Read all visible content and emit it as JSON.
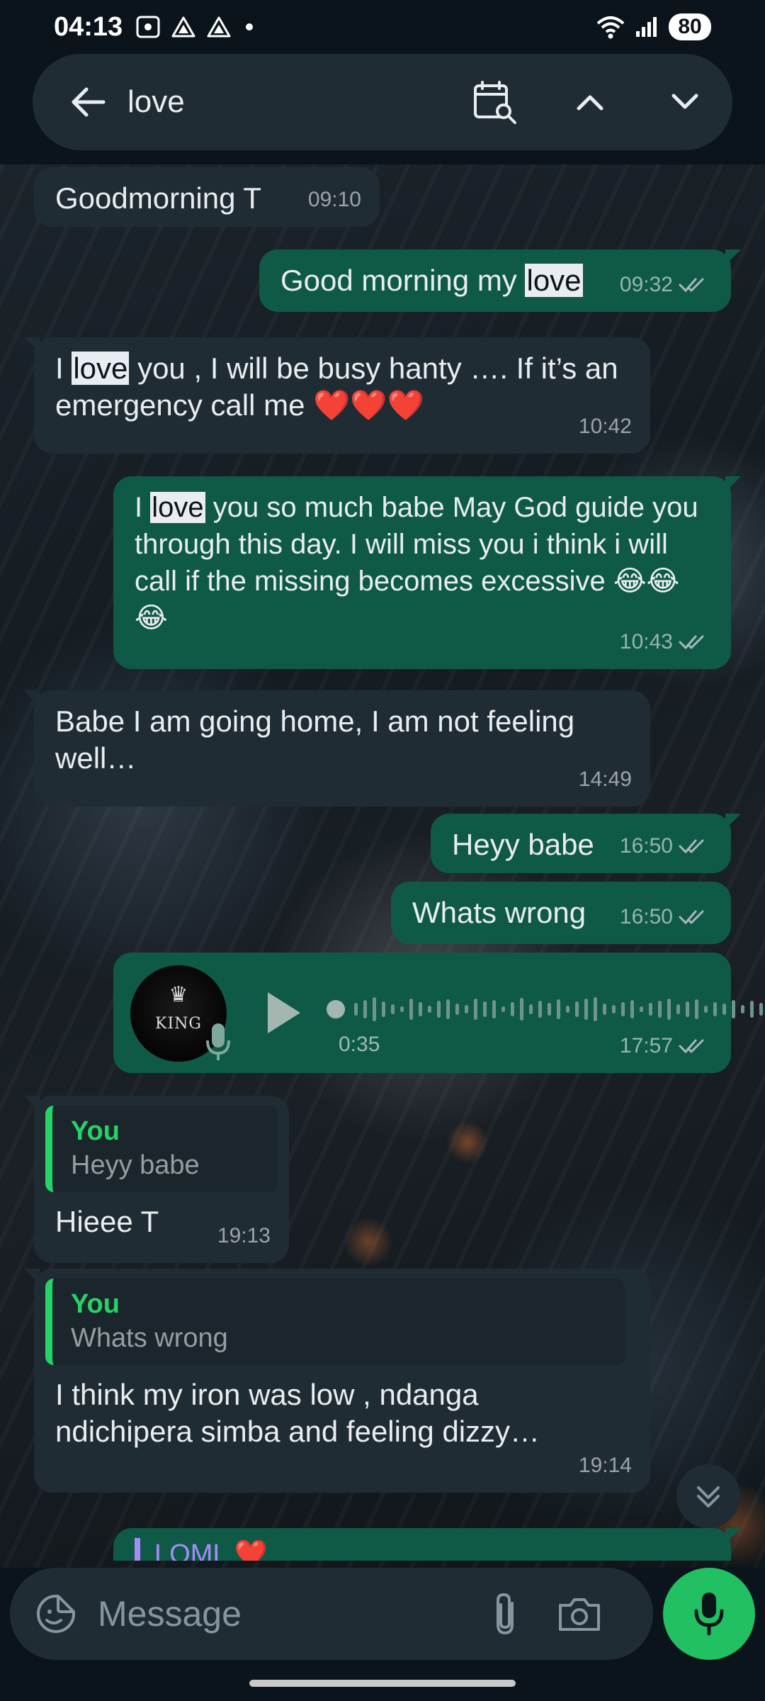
{
  "status_bar": {
    "time": "04:13",
    "battery": "80"
  },
  "search": {
    "query": "love"
  },
  "messages": {
    "m1": {
      "text": "Goodmorning T",
      "time": "09:10"
    },
    "m2": {
      "before": "Good morning my ",
      "highlight": "love",
      "after": "",
      "time": "09:32"
    },
    "m3": {
      "before": "I ",
      "highlight": "love",
      "after": " you , I will be busy hanty …. If it’s an emergency call me ❤️❤️❤️",
      "time": "10:42"
    },
    "m4": {
      "before": "I ",
      "highlight": "love",
      "after": " you so much babe May God guide you through this day. I will miss you i think i will call if the missing becomes excessive 😂😂😂",
      "time": "10:43"
    },
    "m5": {
      "text": "Babe I am going home, I am not feeling well…",
      "time": "14:49"
    },
    "m6": {
      "text": "Heyy babe",
      "time": "16:50"
    },
    "m7": {
      "text": "Whats wrong",
      "time": "16:50"
    },
    "m8": {
      "avatar_text": "KING",
      "duration": "0:35",
      "time": "17:57"
    },
    "m9": {
      "quote_author": "You",
      "quote_text": "Heyy babe",
      "text": "Hieee T",
      "time": "19:13"
    },
    "m10": {
      "quote_author": "You",
      "quote_text": "Whats wrong",
      "text": "I think my iron was low , ndanga ndichipera simba and feeling dizzy…",
      "time": "19:14"
    },
    "m11": {
      "text": "LOML ❤️"
    }
  },
  "composer": {
    "placeholder": "Message"
  },
  "colors": {
    "incoming": "#202c33",
    "outgoing": "#0f5a47",
    "accent": "#21c063",
    "background": "#0b141a"
  }
}
